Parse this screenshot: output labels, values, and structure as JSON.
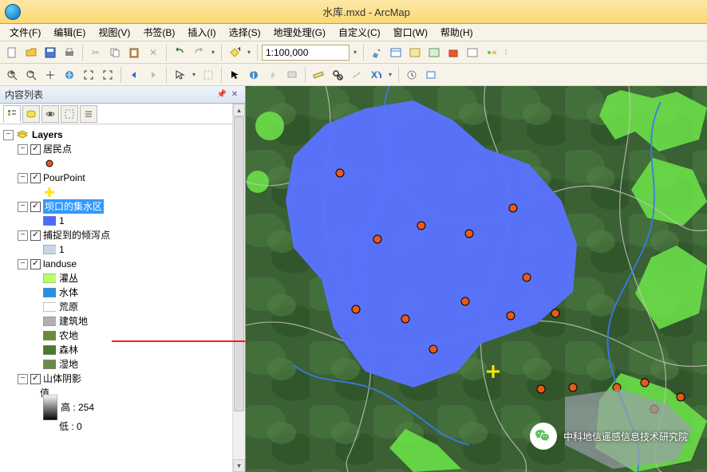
{
  "title": "水库.mxd - ArcMap",
  "menus": [
    "文件(F)",
    "编辑(E)",
    "视图(V)",
    "书签(B)",
    "插入(I)",
    "选择(S)",
    "地理处理(G)",
    "自定义(C)",
    "窗口(W)",
    "帮助(H)"
  ],
  "scale": "1:100,000",
  "toc": {
    "title": "内容列表",
    "root": "Layers",
    "layers": [
      {
        "name": "居民点",
        "symbol": {
          "type": "point",
          "fill": "#e85a1a",
          "stroke": "#000"
        }
      },
      {
        "name": "PourPoint",
        "symbol": {
          "type": "cross",
          "color": "#ffe600"
        }
      },
      {
        "name": "坝口的集水区",
        "selected": true,
        "classes": [
          {
            "label": "1",
            "fill": "#4a6cff",
            "stroke": "#888"
          }
        ]
      },
      {
        "name": "捕捉到的倾泻点",
        "classes": [
          {
            "label": "1",
            "fill": "#c6d6e6",
            "stroke": "#888"
          }
        ]
      },
      {
        "name": "landuse",
        "classes": [
          {
            "label": "灌丛",
            "fill": "#b8ff66",
            "stroke": "#888"
          },
          {
            "label": "水体",
            "fill": "#2b8fe6",
            "stroke": "#888"
          },
          {
            "label": "荒原",
            "fill": "#ffffff",
            "stroke": "#888"
          },
          {
            "label": "建筑地",
            "fill": "#b0b0b0",
            "stroke": "#888"
          },
          {
            "label": "农地",
            "fill": "#6a8a3a",
            "stroke": "#888"
          },
          {
            "label": "森林",
            "fill": "#4a7a2a",
            "stroke": "#888"
          },
          {
            "label": "湿地",
            "fill": "#6a8a4a",
            "stroke": "#888"
          }
        ]
      },
      {
        "name": "山体阴影",
        "ramp": {
          "label": "值",
          "high": "高 : 254",
          "low": "低 : 0"
        }
      }
    ]
  },
  "watermark": "中科地信遥感信息技术研究院",
  "colors": {
    "accent": "#fcd873",
    "selection": "#3399ff",
    "watershed": "#5a73ff"
  }
}
